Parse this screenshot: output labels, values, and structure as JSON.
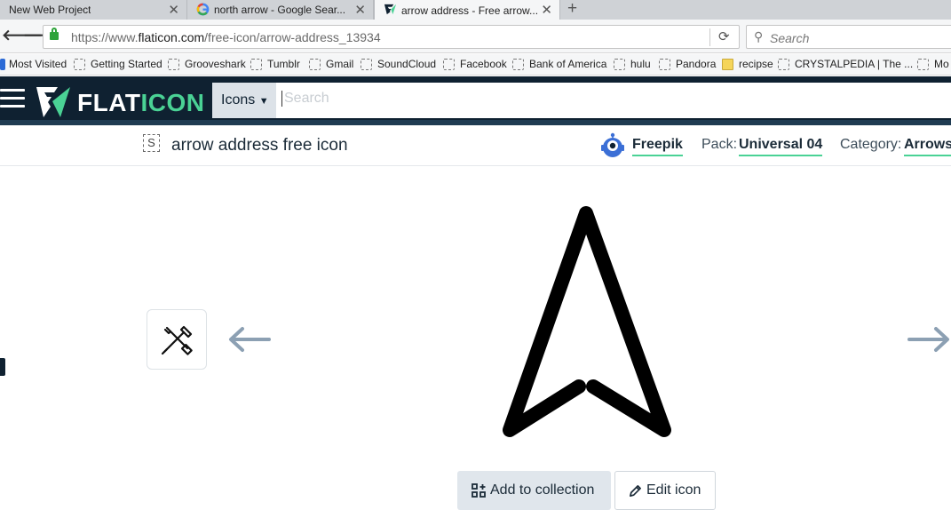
{
  "browser": {
    "tabs": [
      {
        "title": "New Web Project",
        "active": false,
        "favicon": "none"
      },
      {
        "title": "north arrow - Google Sear...",
        "active": false,
        "favicon": "google-icon"
      },
      {
        "title": "arrow address - Free arrow...",
        "active": true,
        "favicon": "flaticon-icon"
      }
    ],
    "new_tab": "+",
    "url_prefix": "https://www.",
    "url_host": "flaticon.com",
    "url_path": "/free-icon/arrow-address_13934",
    "search_placeholder": "Search"
  },
  "bookmarks": [
    {
      "label": "Most Visited",
      "icon": "bookmark-star-icon"
    },
    {
      "label": "Getting Started",
      "icon": "page-icon"
    },
    {
      "label": "Grooveshark",
      "icon": "page-icon"
    },
    {
      "label": "Tumblr",
      "icon": "page-icon"
    },
    {
      "label": "Gmail",
      "icon": "page-icon"
    },
    {
      "label": "SoundCloud",
      "icon": "page-icon"
    },
    {
      "label": "Facebook",
      "icon": "page-icon"
    },
    {
      "label": "Bank of America",
      "icon": "page-icon"
    },
    {
      "label": "hulu",
      "icon": "page-icon"
    },
    {
      "label": "Pandora",
      "icon": "page-icon"
    },
    {
      "label": "recipse",
      "icon": "folder-icon"
    },
    {
      "label": "CRYSTALPEDIA | The ...",
      "icon": "page-icon"
    },
    {
      "label": "Mo",
      "icon": "page-icon"
    }
  ],
  "site": {
    "logo_prefix": "FLAT",
    "logo_suffix": "ICON",
    "search_category": "Icons",
    "search_placeholder": "Search",
    "brand_color": "#4ad295",
    "header_color": "#0f2131"
  },
  "detail": {
    "badge": "S",
    "title": "arrow address free icon",
    "author": "Freepik",
    "pack_label": "Pack:",
    "pack_value": "Universal 04",
    "category_label": "Category:",
    "category_value": "Arrows"
  },
  "actions": {
    "add_to_collection": "Add to collection",
    "edit_icon": "Edit icon"
  }
}
